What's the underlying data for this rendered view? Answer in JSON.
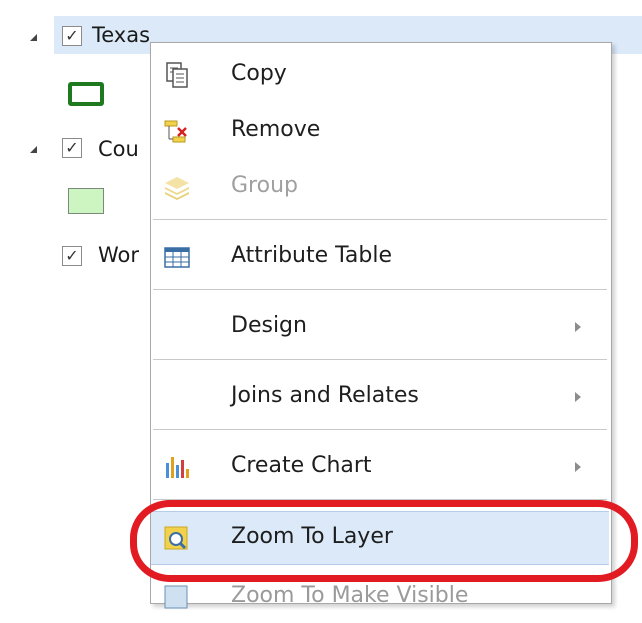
{
  "tree": {
    "items": [
      {
        "label": "Texas",
        "checked_mark": "✓"
      },
      {
        "label": "Cou",
        "checked_mark": "✓"
      },
      {
        "label": "Wor",
        "checked_mark": "✓"
      }
    ],
    "texas_swatch_color": "#1f7a1f",
    "counties_swatch_color": "#ccf5c2"
  },
  "menu": {
    "items": [
      {
        "label": "Copy",
        "icon": "copy-icon"
      },
      {
        "label": "Remove",
        "icon": "remove-icon"
      },
      {
        "label": "Group",
        "icon": "group-layers-icon",
        "disabled": true
      },
      {
        "label": "Attribute Table",
        "icon": "table-icon"
      },
      {
        "label": "Design",
        "submenu": true
      },
      {
        "label": "Joins and Relates",
        "submenu": true
      },
      {
        "label": "Create Chart",
        "icon": "bar-chart-icon",
        "submenu": true
      },
      {
        "label": "Zoom To Layer",
        "icon": "zoom-to-layer-icon",
        "highlighted": true
      },
      {
        "label": "Zoom To Make Visible",
        "icon": "zoom-to-visible-icon"
      }
    ]
  },
  "colors": {
    "selection": "#dbe9f8",
    "annotation_ring": "#e21a22"
  }
}
